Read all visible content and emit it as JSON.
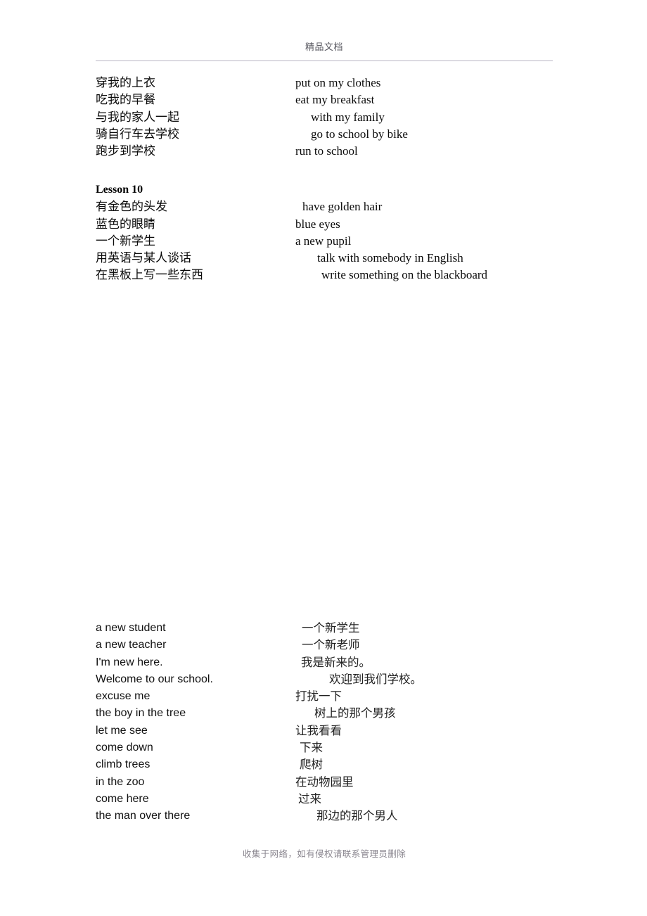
{
  "header": {
    "title": "精品文档"
  },
  "footer": {
    "note": "收集于网络，如有侵权请联系管理员删除"
  },
  "top_section": {
    "rows": [
      {
        "left": "穿我的上衣",
        "right": "put on my clothes",
        "right_indent": 0
      },
      {
        "left": "吃我的早餐",
        "right": "eat my breakfast",
        "right_indent": 0
      },
      {
        "left": "与我的家人一起",
        "right": "with my family",
        "right_indent": 22
      },
      {
        "left": "骑自行车去学校",
        "right": "go to school by bike",
        "right_indent": 22
      },
      {
        "left": "跑步到学校",
        "right": "run to school",
        "right_indent": 0
      }
    ]
  },
  "lesson": {
    "heading": "Lesson 10",
    "rows": [
      {
        "left": "有金色的头发",
        "right": "have golden hair",
        "right_indent": 10
      },
      {
        "left": "蓝色的眼睛",
        "right": "blue eyes",
        "right_indent": 0
      },
      {
        "left": "一个新学生",
        "right": "a new pupil",
        "right_indent": 0
      },
      {
        "left": "用英语与某人谈话",
        "right": "talk with somebody in English",
        "right_indent": 31
      },
      {
        "left": "在黑板上写一些东西",
        "right": "write something on the blackboard",
        "right_indent": 37
      }
    ]
  },
  "bottom_section": {
    "rows": [
      {
        "left": "a new student",
        "right": "一个新学生",
        "right_indent": 9
      },
      {
        "left": "a new teacher",
        "right": "一个新老师",
        "right_indent": 9
      },
      {
        "left": "I'm new here.",
        "right": "我是新来的。",
        "right_indent": 8
      },
      {
        "left": "Welcome to our school.",
        "right": "欢迎到我们学校。",
        "right_indent": 48
      },
      {
        "left": "excuse me",
        "right": "打扰一下",
        "right_indent": 0
      },
      {
        "left": "the boy in the tree",
        "right": "树上的那个男孩",
        "right_indent": 27
      },
      {
        "left": "let me see",
        "right": "让我看看",
        "right_indent": 0
      },
      {
        "left": "come down",
        "right": "下来",
        "right_indent": 6
      },
      {
        "left": "climb trees",
        "right": "爬树",
        "right_indent": 6
      },
      {
        "left": "in the zoo",
        "right": "在动物园里",
        "right_indent": 0
      },
      {
        "left": "come here",
        "right": "过来",
        "right_indent": 4
      },
      {
        "left": "the man over there",
        "right": "那边的那个男人",
        "right_indent": 30
      }
    ]
  }
}
